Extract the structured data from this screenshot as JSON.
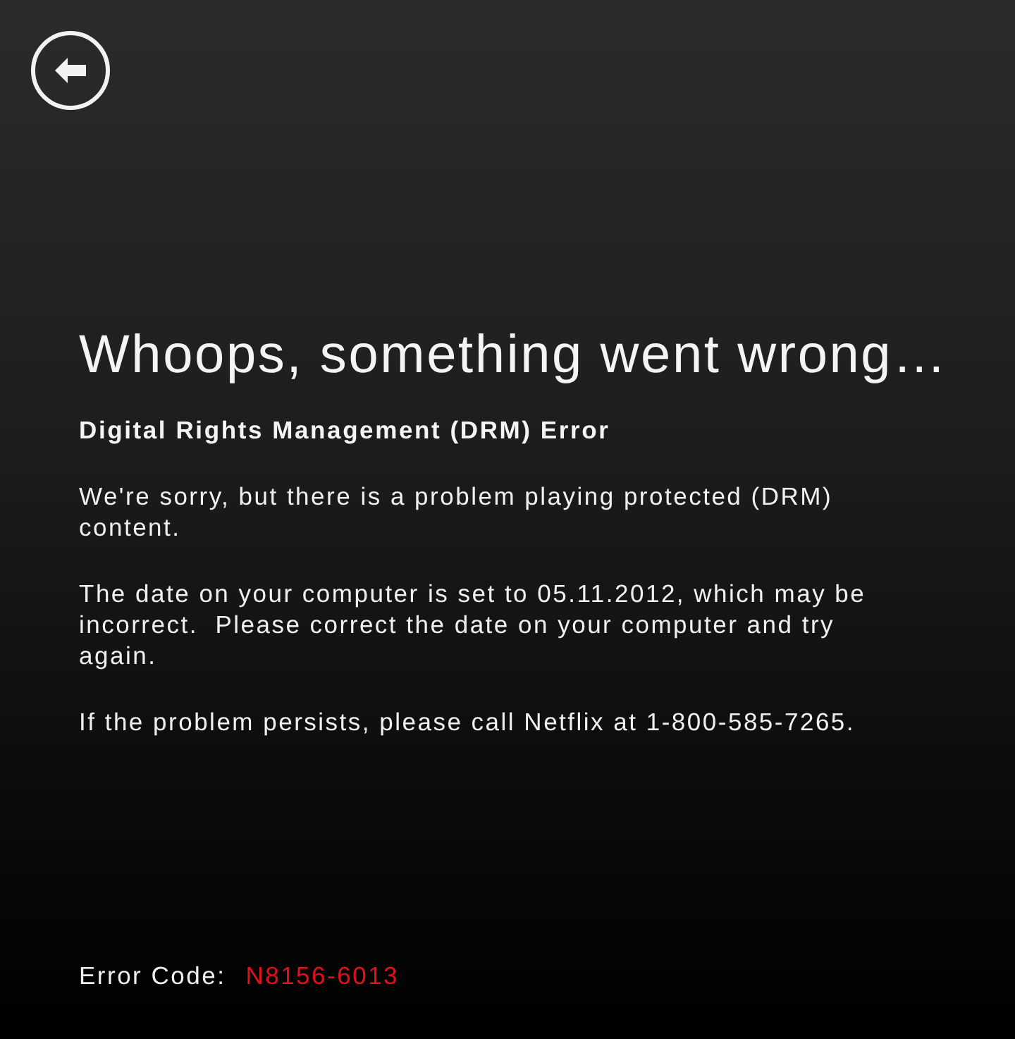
{
  "title": "Whoops, something went wrong…",
  "subtitle": "Digital Rights Management (DRM) Error",
  "paragraphs": [
    "We're sorry, but there is a problem playing protected (DRM) content.",
    "The date on your computer is set to 05.11.2012, which may be incorrect.  Please correct the date on your computer and try again.",
    "If the problem persists, please call Netflix at 1-800-585-7265."
  ],
  "error_code": {
    "label": "Error Code:",
    "value": "N8156-6013"
  }
}
